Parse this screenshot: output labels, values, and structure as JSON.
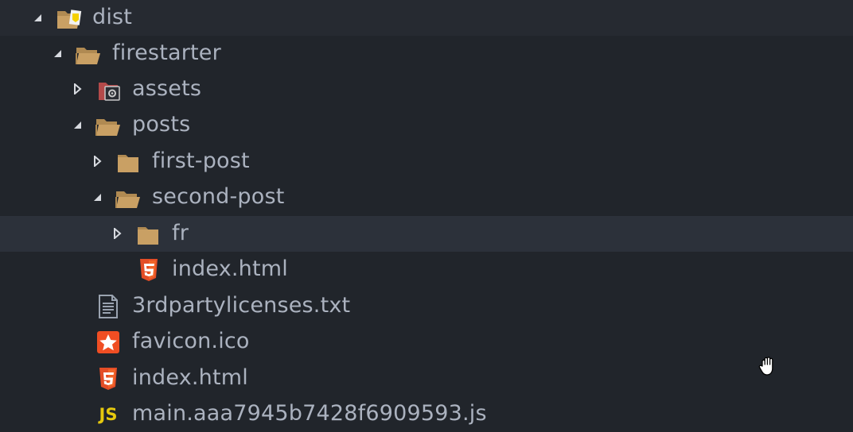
{
  "tree": [
    {
      "label": "dist",
      "icon": "folder-open-dist-icon",
      "arrow": "expanded"
    },
    {
      "label": "firestarter",
      "icon": "folder-open-icon",
      "arrow": "expanded"
    },
    {
      "label": "assets",
      "icon": "folder-assets-icon",
      "arrow": "collapsed"
    },
    {
      "label": "posts",
      "icon": "folder-open-icon",
      "arrow": "expanded"
    },
    {
      "label": "first-post",
      "icon": "folder-closed-icon",
      "arrow": "collapsed"
    },
    {
      "label": "second-post",
      "icon": "folder-open-icon",
      "arrow": "expanded"
    },
    {
      "label": "fr",
      "icon": "folder-closed-icon",
      "arrow": "collapsed",
      "selected": true
    },
    {
      "label": "index.html",
      "icon": "html5-icon"
    },
    {
      "label": "3rdpartylicenses.txt",
      "icon": "text-file-icon"
    },
    {
      "label": "favicon.ico",
      "icon": "favicon-star-icon"
    },
    {
      "label": "index.html",
      "icon": "html5-icon"
    },
    {
      "label": "main.aaa7945b7428f6909593.js",
      "icon": "javascript-icon",
      "icon_text": "JS"
    }
  ],
  "colors": {
    "background": "#21252b",
    "selected_row": "#2c313a",
    "text": "#abb2bf",
    "folder": "#c9a064",
    "html5": "#e44d26",
    "js": "#e5c80e"
  }
}
